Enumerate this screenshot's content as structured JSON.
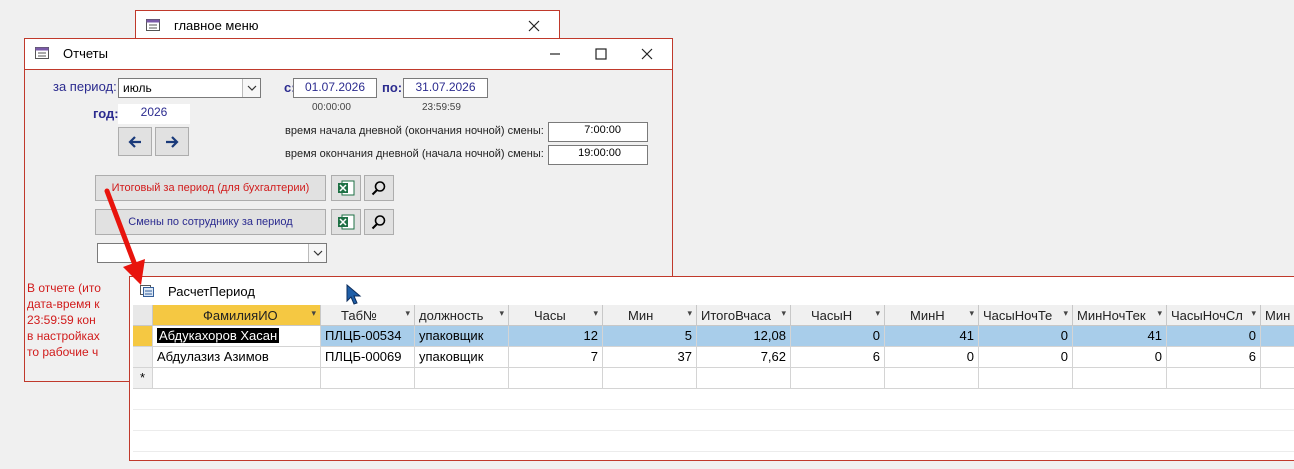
{
  "main_menu": {
    "title": "главное меню"
  },
  "reports": {
    "title": "Отчеты",
    "period_label": "за период:",
    "period_value": "июль",
    "year_label": "год:",
    "year_value": "2026",
    "from_label": "с:",
    "from_date": "01.07.2026",
    "from_time": "00:00:00",
    "to_label": "по:",
    "to_date": "31.07.2026",
    "to_time": "23:59:59",
    "day_start_label": "время начала дневной (окончания ночной) смены:",
    "day_start_value": "7:00:00",
    "day_end_label": "время окончания дневной (начала ночной) смены:",
    "day_end_value": "19:00:00",
    "btn_total": "Итоговый за период (для бухгалтерии)",
    "btn_shifts": "Смены по сотруднику за период",
    "note_lines": [
      "В отчете (ито",
      "дата-время к",
      "23:59:59 кон",
      "в настройках",
      "то рабочие ч"
    ]
  },
  "datasheet": {
    "title": "РасчетПериод",
    "columns": [
      "ФамилияИО",
      "Таб№",
      "должность",
      "Часы",
      "Мин",
      "ИтогоВчаса",
      "ЧасыН",
      "МинН",
      "ЧасыНочТе",
      "МинНочТек",
      "ЧасыНочСл",
      "Мин"
    ],
    "rows": [
      [
        "Абдукахоров Хасан",
        "ПЛЦБ-00534",
        "упаковщик",
        "12",
        "5",
        "12,08",
        "0",
        "41",
        "0",
        "41",
        "0",
        ""
      ],
      [
        "Абдулазиз Азимов",
        "ПЛЦБ-00069",
        "упаковщик",
        "7",
        "37",
        "7,62",
        "6",
        "0",
        "0",
        "0",
        "6",
        ""
      ]
    ],
    "new_row_marker": "*"
  },
  "colors": {
    "border_accent": "#c0392b",
    "label_blue": "#2b2b8f",
    "note_red": "#d11b1b",
    "selected_row": "#a8cdea"
  }
}
